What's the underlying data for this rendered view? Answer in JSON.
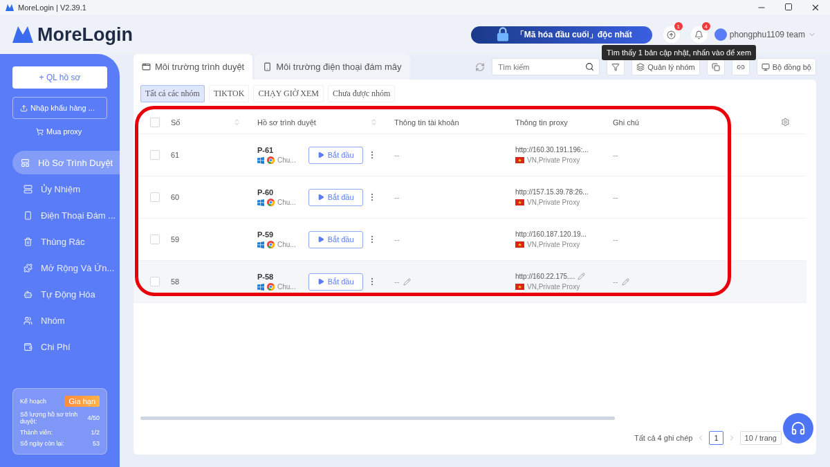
{
  "window": {
    "title": "MoreLogin | V2.39.1"
  },
  "header": {
    "logo": "MoreLogin",
    "banner": "「Mã hóa đầu cuối」độc nhất",
    "update_badge": "1",
    "notification_badge": "4",
    "account": "phongphu1109 team",
    "tooltip": "Tìm thấy 1 bản cập nhật, nhấn vào để xem"
  },
  "sidebar": {
    "create_button": "+ QL hồ sơ",
    "import_button": "Nhập khẩu hàng ...",
    "buy_link": "Mua proxy",
    "items": [
      {
        "label": "Hồ Sơ Trình Duyệt",
        "selected": true
      },
      {
        "label": "Ủy Nhiệm",
        "selected": false
      },
      {
        "label": "Điện Thoại Đám ...",
        "selected": false
      },
      {
        "label": "Thùng Rác",
        "selected": false
      },
      {
        "label": "Mở Rộng Và Ứn...",
        "selected": false
      },
      {
        "label": "Tự Động Hóa",
        "selected": false
      },
      {
        "label": "Nhóm",
        "selected": false
      },
      {
        "label": "Chi Phí",
        "selected": false
      }
    ],
    "plan": {
      "label": "Kế hoạch",
      "renew_button": "Gia hạn",
      "stats": [
        {
          "label": "Số lượng hồ sơ trình duyệt:",
          "value": "4/50"
        },
        {
          "label": "Thành viên:",
          "value": "1/2"
        },
        {
          "label": "Số ngày còn lại:",
          "value": "53"
        }
      ]
    }
  },
  "tabs": [
    {
      "label": "Môi trường trình duyệt",
      "selected": true
    },
    {
      "label": "Môi trường điện thoại đám mây",
      "selected": false
    }
  ],
  "groups": [
    {
      "label": "Tất cả các nhóm",
      "selected": true
    },
    {
      "label": "TIKTOK",
      "selected": false
    },
    {
      "label": "CHẠY GIỜ XEM",
      "selected": false
    },
    {
      "label": "Chưa được nhóm",
      "selected": false
    }
  ],
  "toolbar": {
    "search_placeholder": "Tìm kiếm",
    "group_button": "Quản lý nhóm",
    "sync_button": "Bộ đồng bộ"
  },
  "table": {
    "select_all_checked": false,
    "columns": [
      {
        "label": "Số",
        "sortable": true
      },
      {
        "label": "Hồ sơ trình duyệt",
        "sortable": true
      },
      {
        "label": "Thông tin tài khoản",
        "sortable": false
      },
      {
        "label": "Thông tin proxy",
        "sortable": false
      },
      {
        "label": "Ghi chú",
        "sortable": false
      }
    ],
    "rows": [
      {
        "number": "61",
        "name": "P-61",
        "browser": "Chu...",
        "start": "Bắt đầu",
        "account": "--",
        "proxy": "http://160.30.191.196:...",
        "proxy_label": "VN,Private Proxy",
        "note": "--",
        "checked": false,
        "hovered": false
      },
      {
        "number": "60",
        "name": "P-60",
        "browser": "Chu...",
        "start": "Bắt đầu",
        "account": "--",
        "proxy": "http://157.15.39.78:26...",
        "proxy_label": "VN,Private Proxy",
        "note": "--",
        "checked": false,
        "hovered": false
      },
      {
        "number": "59",
        "name": "P-59",
        "browser": "Chu...",
        "start": "Bắt đầu",
        "account": "--",
        "proxy": "http://160.187.120.19...",
        "proxy_label": "VN,Private Proxy",
        "note": "--",
        "checked": false,
        "hovered": false
      },
      {
        "number": "58",
        "name": "P-58",
        "browser": "Chu...",
        "start": "Bắt đầu",
        "account": "--",
        "proxy": "http://160.22.175....",
        "proxy_label": "VN,Private Proxy",
        "note": "--",
        "checked": false,
        "hovered": true
      }
    ]
  },
  "pagination": {
    "total": "Tất cả 4 ghi chép",
    "page": "1",
    "page_size": "10 / trang"
  }
}
